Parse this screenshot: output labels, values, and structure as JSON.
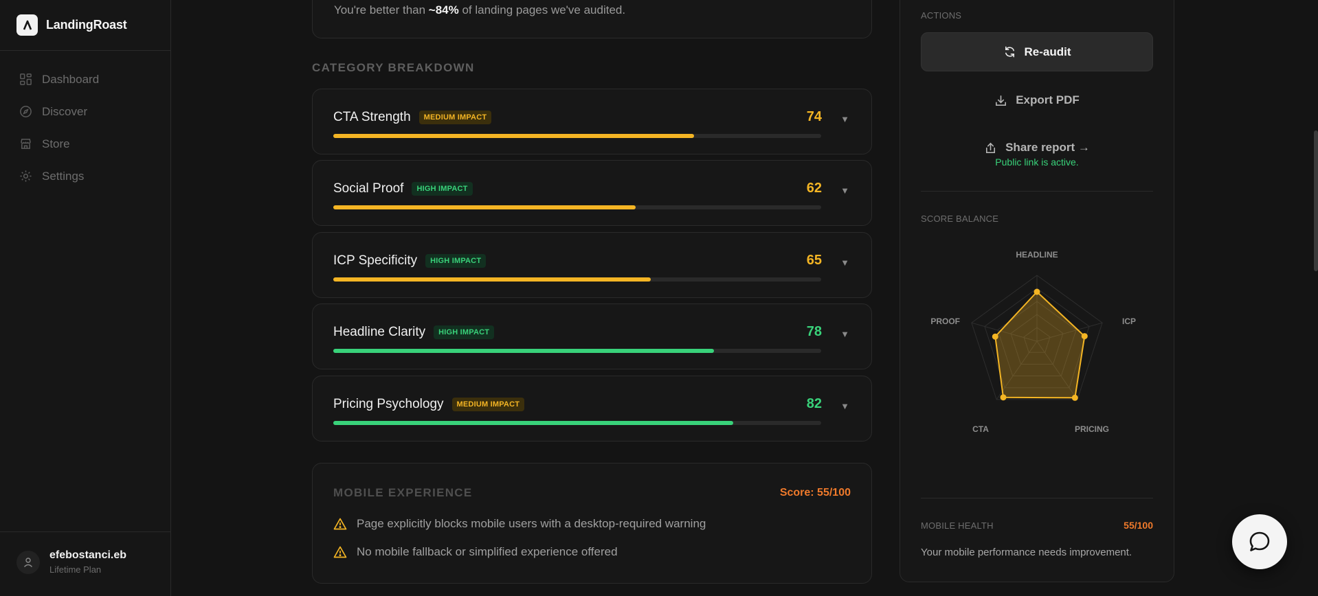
{
  "app": {
    "name": "LandingRoast"
  },
  "sidebar": {
    "items": [
      {
        "label": "Dashboard",
        "icon": "dashboard-icon"
      },
      {
        "label": "Discover",
        "icon": "compass-icon"
      },
      {
        "label": "Store",
        "icon": "store-icon"
      },
      {
        "label": "Settings",
        "icon": "gear-icon"
      }
    ],
    "user": {
      "name": "efebostanci.eb",
      "plan": "Lifetime Plan"
    }
  },
  "summary": {
    "prefix": "You're better than ",
    "highlight": "~84%",
    "suffix": " of landing pages we've audited."
  },
  "breakdown": {
    "title": "CATEGORY BREAKDOWN",
    "items": [
      {
        "name": "CTA Strength",
        "impact": "MEDIUM IMPACT",
        "impact_level": "medium",
        "score": "74",
        "value": 74,
        "color": "#f4b524"
      },
      {
        "name": "Social Proof",
        "impact": "HIGH IMPACT",
        "impact_level": "high",
        "score": "62",
        "value": 62,
        "color": "#f4b524"
      },
      {
        "name": "ICP Specificity",
        "impact": "HIGH IMPACT",
        "impact_level": "high",
        "score": "65",
        "value": 65,
        "color": "#f4b524"
      },
      {
        "name": "Headline Clarity",
        "impact": "HIGH IMPACT",
        "impact_level": "high",
        "score": "78",
        "value": 78,
        "color": "#39d27a"
      },
      {
        "name": "Pricing Psychology",
        "impact": "MEDIUM IMPACT",
        "impact_level": "medium",
        "score": "82",
        "value": 82,
        "color": "#39d27a"
      }
    ]
  },
  "mobile": {
    "title": "MOBILE EXPERIENCE",
    "score": "Score: 55/100",
    "issues": [
      "Page explicitly blocks mobile users with a desktop-required warning",
      "No mobile fallback or simplified experience offered"
    ]
  },
  "actions": {
    "title": "ACTIONS",
    "reaudit": "Re-audit",
    "export": "Export PDF",
    "share": "Share report →",
    "public_status": "Public link is active."
  },
  "score_balance": {
    "title": "SCORE BALANCE",
    "labels": {
      "headline": "HEADLINE",
      "icp": "ICP",
      "pricing": "PRICING",
      "cta": "CTA",
      "proof": "PROOF"
    }
  },
  "mobile_health": {
    "title": "MOBILE HEALTH",
    "score": "55/100",
    "message": "Your mobile performance needs improvement."
  },
  "colors": {
    "accent_yellow": "#f4b524",
    "accent_green": "#39d27a",
    "accent_orange": "#f07a2b"
  }
}
